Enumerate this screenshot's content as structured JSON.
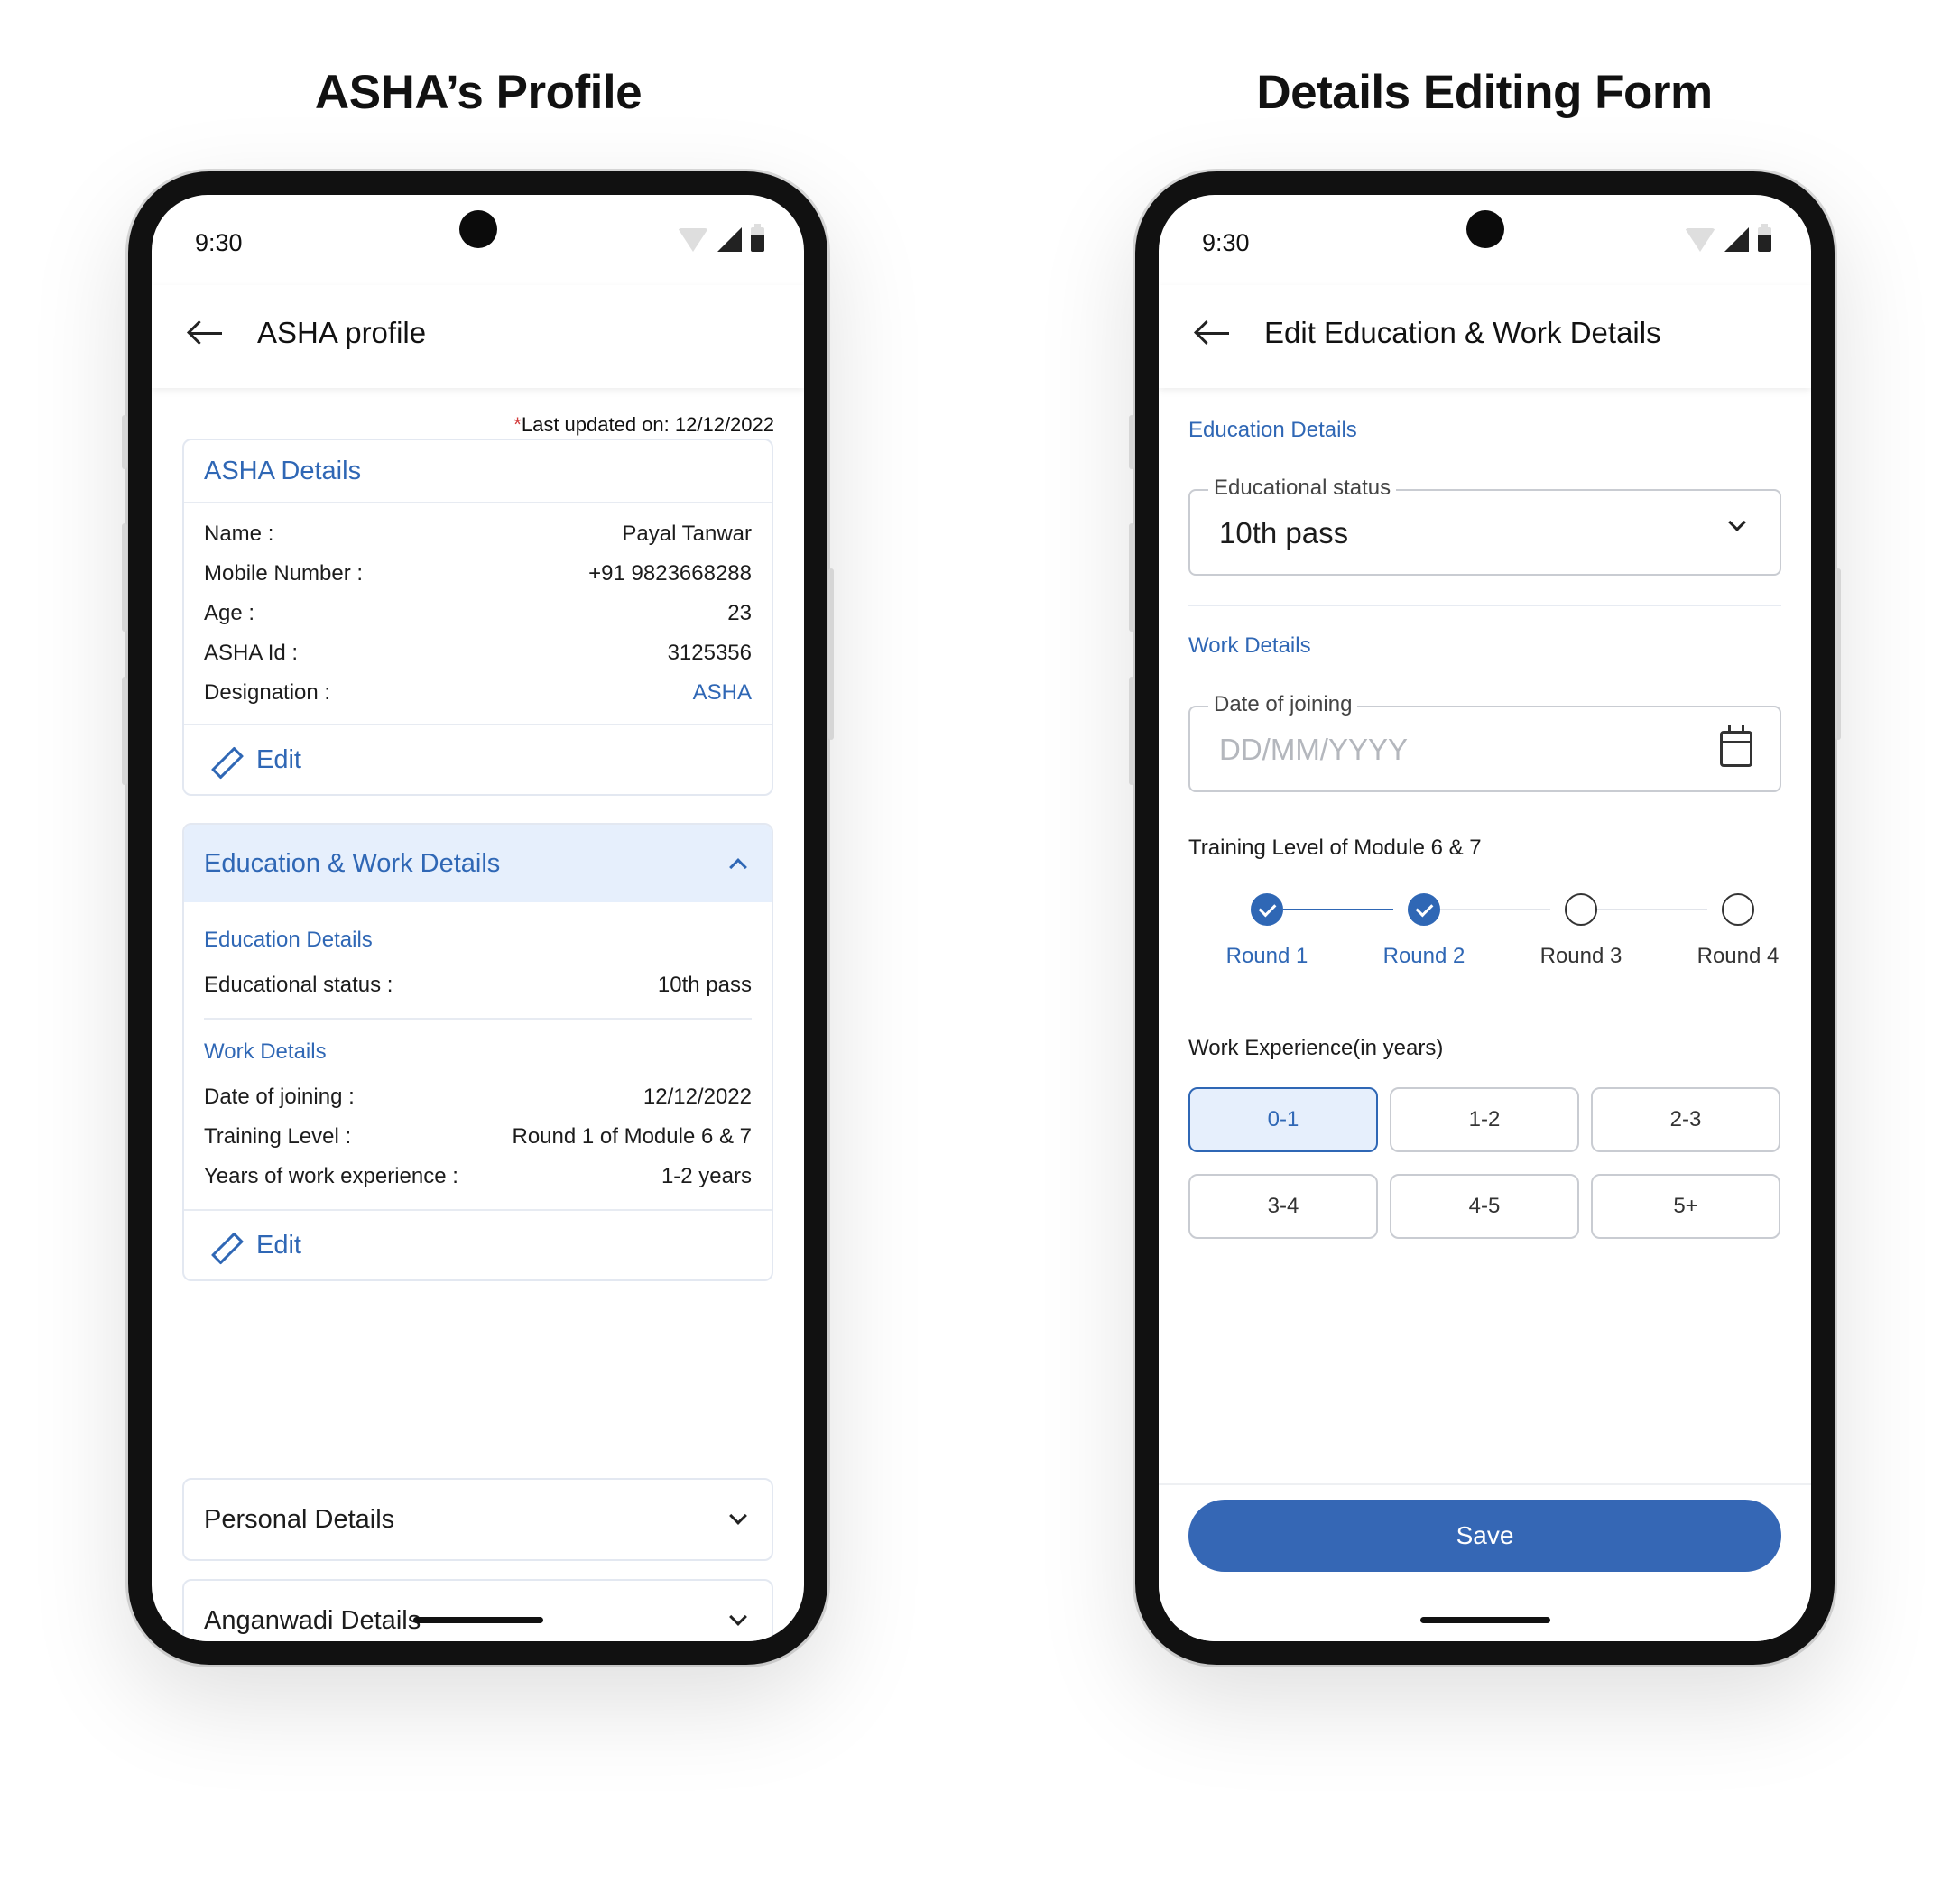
{
  "headings": {
    "left": "ASHA’s Profile",
    "right": "Details Editing Form"
  },
  "status_bar": {
    "time": "9:30"
  },
  "profile_screen": {
    "title": "ASHA profile",
    "last_updated_star": "*",
    "last_updated": "Last updated on: 12/12/2022",
    "asha_details": {
      "header": "ASHA Details",
      "rows": [
        {
          "label": "Name :",
          "value": "Payal Tanwar"
        },
        {
          "label": "Mobile Number :",
          "value": "+91 9823668288"
        },
        {
          "label": "Age :",
          "value": "23"
        },
        {
          "label": "ASHA Id :",
          "value": "3125356"
        },
        {
          "label": "Designation :",
          "value": "ASHA"
        }
      ],
      "edit": "Edit"
    },
    "education_work": {
      "header": "Education & Work Details",
      "education_title": "Education Details",
      "education_rows": [
        {
          "label": "Educational status :",
          "value": "10th pass"
        }
      ],
      "work_title": "Work Details",
      "work_rows": [
        {
          "label": "Date of joining :",
          "value": "12/12/2022"
        },
        {
          "label": "Training Level :",
          "value": "Round 1 of Module 6 & 7"
        },
        {
          "label": "Years of work experience :",
          "value": "1-2 years"
        }
      ],
      "edit": "Edit"
    },
    "personal_details": "Personal Details",
    "anganwadi_details": "Anganwadi Details"
  },
  "edit_screen": {
    "title": "Edit Education & Work Details",
    "education_section": "Education Details",
    "educational_status": {
      "label": "Educational status",
      "value": "10th pass"
    },
    "work_section": "Work Details",
    "date_of_joining": {
      "label": "Date of joining",
      "placeholder": "DD/MM/YYYY"
    },
    "training_label": "Training Level of Module 6 & 7",
    "rounds": [
      {
        "label": "Round 1",
        "completed": true
      },
      {
        "label": "Round 2",
        "completed": true
      },
      {
        "label": "Round 3",
        "completed": false
      },
      {
        "label": "Round 4",
        "completed": false
      }
    ],
    "experience_label": "Work Experience(in years)",
    "experience_options": [
      "0-1",
      "1-2",
      "2-3",
      "3-4",
      "4-5",
      "5+"
    ],
    "experience_selected": "0-1",
    "save": "Save"
  },
  "colors": {
    "accent": "#2f67b5",
    "button": "#3567b5",
    "selected_bg": "#e6effc",
    "required_star": "#d23b3b"
  }
}
